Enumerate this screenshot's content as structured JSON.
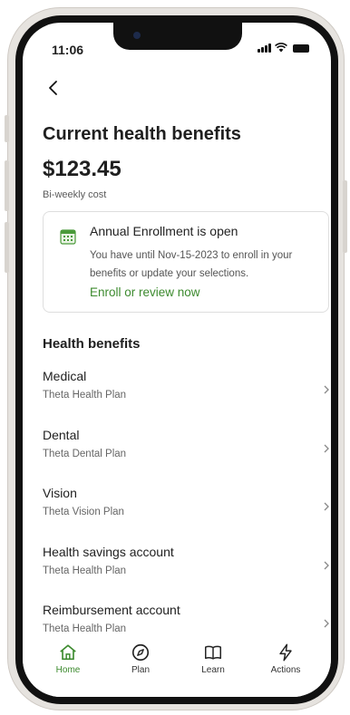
{
  "status_bar": {
    "time": "11:06"
  },
  "header": {
    "title": "Current health benefits",
    "amount": "$123.45",
    "cost_label": "Bi-weekly cost"
  },
  "notice": {
    "title": "Annual Enrollment is open",
    "body": "You have until Nov-15-2023 to enroll in your benefits or update your selections.",
    "link": "Enroll or review now"
  },
  "section_title": "Health benefits",
  "benefits": [
    {
      "name": "Medical",
      "plan": "Theta Health Plan"
    },
    {
      "name": "Dental",
      "plan": "Theta Dental Plan"
    },
    {
      "name": "Vision",
      "plan": "Theta Vision Plan"
    },
    {
      "name": "Health savings account",
      "plan": "Theta Health Plan"
    },
    {
      "name": "Reimbursement account",
      "plan": "Theta Health Plan"
    }
  ],
  "tabs": [
    {
      "label": "Home",
      "icon": "home-icon",
      "active": true
    },
    {
      "label": "Plan",
      "icon": "compass-icon",
      "active": false
    },
    {
      "label": "Learn",
      "icon": "book-icon",
      "active": false
    },
    {
      "label": "Actions",
      "icon": "lightning-icon",
      "active": false
    }
  ],
  "colors": {
    "accent": "#3c8a2e",
    "text": "#1f1f1f",
    "muted": "#666666"
  }
}
